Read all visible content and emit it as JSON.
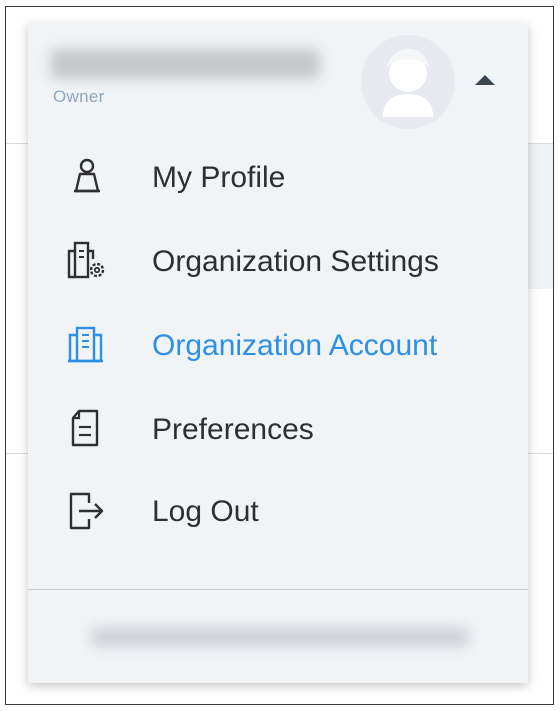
{
  "account": {
    "user_name": "",
    "role": "Owner",
    "email": ""
  },
  "menu": {
    "items": [
      {
        "label": "My Profile",
        "icon": "person-icon",
        "active": false
      },
      {
        "label": "Organization Settings",
        "icon": "building-gear-icon",
        "active": false
      },
      {
        "label": "Organization Account",
        "icon": "building-icon",
        "active": true
      },
      {
        "label": "Preferences",
        "icon": "document-icon",
        "active": false
      },
      {
        "label": "Log Out",
        "icon": "logout-icon",
        "active": false
      }
    ]
  },
  "colors": {
    "menu_bg": "#f0f4f7",
    "text": "#2f2f33",
    "active_text": "#2d8fe6",
    "role_text": "#8fa6bd",
    "icon_stroke": "#2f2f33"
  }
}
